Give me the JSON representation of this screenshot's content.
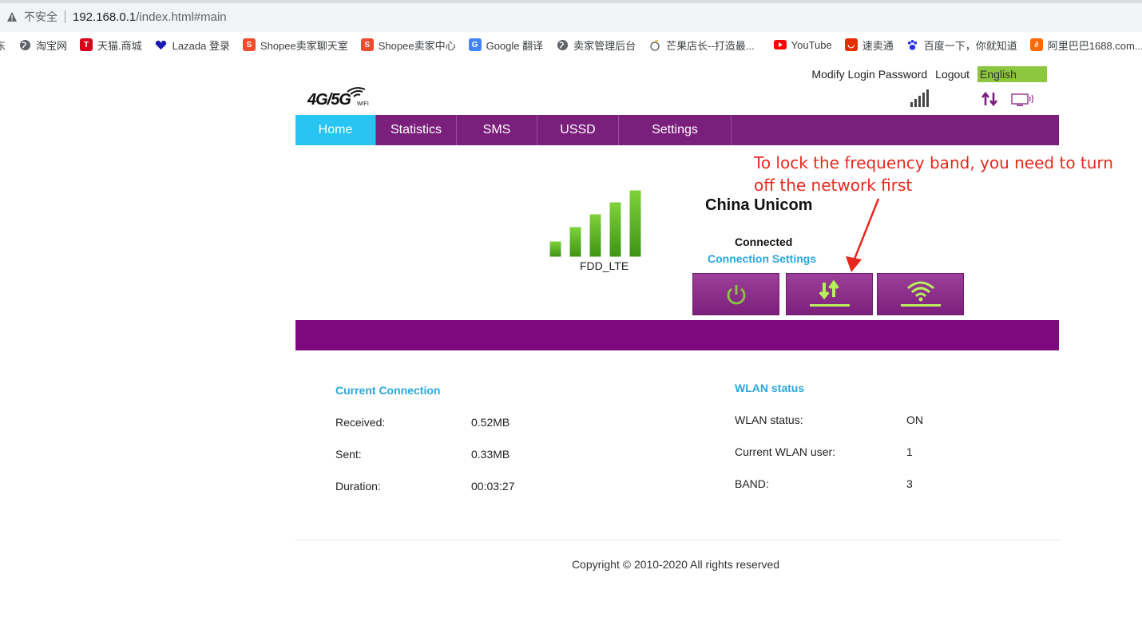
{
  "browser": {
    "insecure_label": "不安全",
    "url_host": "192.168.0.1",
    "url_path": "/index.html#main",
    "bookmarks": [
      {
        "label": "东",
        "icon": "globe-icon",
        "color": "#ffffff"
      },
      {
        "label": "淘宝网",
        "icon": "globe-icon",
        "color": "#5f6368"
      },
      {
        "label": "天猫.商城",
        "icon": "tmall-icon",
        "color": "#d9001b"
      },
      {
        "label": "Lazada 登录",
        "icon": "lazada-icon",
        "color": "#1a1ab0"
      },
      {
        "label": "Shopee卖家聊天室",
        "icon": "shopee-icon",
        "color": "#ee4d2d"
      },
      {
        "label": "Shopee卖家中心",
        "icon": "shopee-icon",
        "color": "#ee4d2d"
      },
      {
        "label": "Google 翻译",
        "icon": "google-translate-icon",
        "color": "#4285f4"
      },
      {
        "label": "卖家管理后台",
        "icon": "globe-icon",
        "color": "#5f6368"
      },
      {
        "label": "芒果店长--打造最...",
        "icon": "mango-icon",
        "color": "#f5a623"
      },
      {
        "label": "YouTube",
        "icon": "youtube-icon",
        "color": "#ff0000"
      },
      {
        "label": "速卖通",
        "icon": "aliexpress-icon",
        "color": "#e62e04"
      },
      {
        "label": "百度一下，你就知道",
        "icon": "baidu-icon",
        "color": "#2932e1"
      },
      {
        "label": "阿里巴巴1688.com...",
        "icon": "alibaba-icon",
        "color": "#ff6a00"
      }
    ]
  },
  "header": {
    "modify_password": "Modify Login Password",
    "logout": "Logout",
    "language": "English",
    "logo_text": "4G/5G",
    "logo_sub": "WIFI"
  },
  "nav": {
    "tabs": [
      {
        "label": "Home",
        "active": true
      },
      {
        "label": "Statistics",
        "active": false
      },
      {
        "label": "SMS",
        "active": false
      },
      {
        "label": "USSD",
        "active": false
      },
      {
        "label": "Settings",
        "active": false
      }
    ]
  },
  "hero": {
    "network_type": "FDD_LTE",
    "carrier": "China Unicom",
    "status": "Connected",
    "connection_settings": "Connection Settings",
    "signal_level": 5,
    "signal_max": 5
  },
  "annotation": {
    "text": "To lock the frequency band, you need to turn off the network first"
  },
  "current_connection": {
    "title": "Current Connection",
    "rows": [
      {
        "label": "Received:",
        "value": "0.52MB"
      },
      {
        "label": "Sent:",
        "value": "0.33MB"
      },
      {
        "label": "Duration:",
        "value": "00:03:27"
      }
    ]
  },
  "wlan": {
    "title": "WLAN status",
    "rows": [
      {
        "label": "WLAN status:",
        "value": "ON"
      },
      {
        "label": "Current WLAN user:",
        "value": "1"
      },
      {
        "label": "BAND:",
        "value": "3"
      }
    ]
  },
  "footer": {
    "copyright": "Copyright © 2010-2020 All rights reserved"
  },
  "colors": {
    "nav_bg": "#7b1f7c",
    "active_tab": "#28c4f2",
    "accent_blue": "#2aa7df",
    "signal_green": "#4caf1a",
    "annotation_red": "#e8281e",
    "language_bg": "#8dc63f"
  }
}
